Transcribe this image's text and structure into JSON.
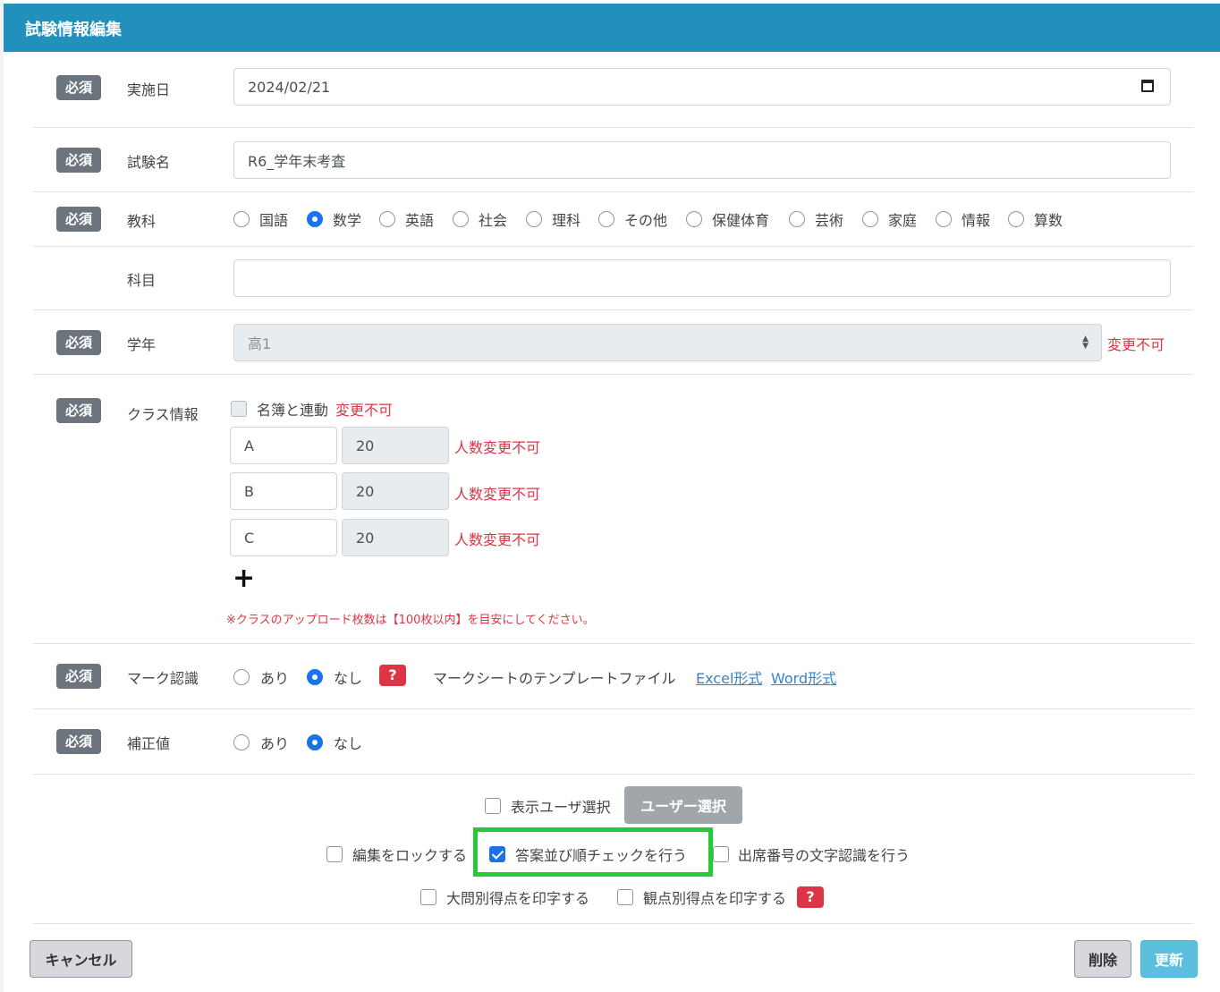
{
  "header": {
    "title": "試験情報編集"
  },
  "required_label": "必須",
  "fields": {
    "date": {
      "label": "実施日",
      "value": "2024/02/21"
    },
    "exam_name": {
      "label": "試験名",
      "value": "R6_学年末考査"
    },
    "subject": {
      "label": "教科",
      "options": [
        "国語",
        "数学",
        "英語",
        "社会",
        "理科",
        "その他",
        "保健体育",
        "芸術",
        "家庭",
        "情報",
        "算数"
      ],
      "selected": "数学"
    },
    "course": {
      "label": "科目",
      "value": ""
    },
    "grade": {
      "label": "学年",
      "value": "高1",
      "note": "変更不可"
    },
    "class_info": {
      "label": "クラス情報",
      "link_label": "名簿と連動",
      "link_note": "変更不可",
      "rows": [
        {
          "name": "A",
          "count": "20",
          "note": "人数変更不可"
        },
        {
          "name": "B",
          "count": "20",
          "note": "人数変更不可"
        },
        {
          "name": "C",
          "count": "20",
          "note": "人数変更不可"
        }
      ],
      "add_icon": "plus-icon",
      "notice": "※クラスのアップロード枚数は【100枚以内】を目安にしてください。"
    },
    "mark_recognition": {
      "label": "マーク認識",
      "yes": "あり",
      "no": "なし",
      "selected": "なし",
      "help": "?",
      "template_text": "マークシートのテンプレートファイル",
      "excel_link": "Excel形式",
      "word_link": "Word形式"
    },
    "correction": {
      "label": "補正値",
      "yes": "あり",
      "no": "なし",
      "selected": "なし"
    }
  },
  "options": {
    "user_select_check": "表示ユーザ選択",
    "user_select_button": "ユーザー選択",
    "lock_edit": "編集をロックする",
    "answer_order_check": "答案並び順チェックを行う",
    "attendance_ocr": "出席番号の文字認識を行う",
    "print_big_question": "大問別得点を印字する",
    "print_viewpoint": "観点別得点を印字する",
    "help": "?"
  },
  "footer": {
    "cancel": "キャンセル",
    "delete": "削除",
    "update": "更新"
  },
  "colors": {
    "header": "#2290bd",
    "accent": "#1a73e8",
    "danger": "#dc3545",
    "highlight": "#22cc33"
  }
}
